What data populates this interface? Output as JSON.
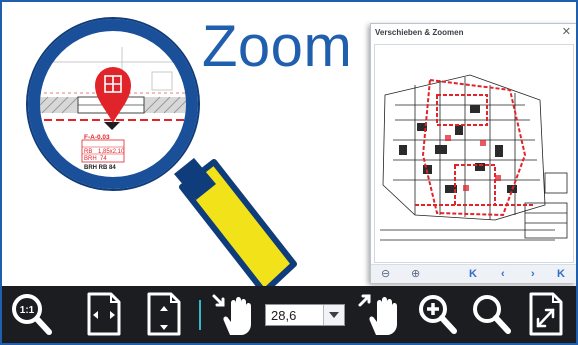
{
  "headline": "Zoom",
  "magnifier": {
    "plan_labels": [
      "F-A-0.03",
      "RB",
      "1,85x2,10",
      "BRH",
      "74",
      "BRH RB 84"
    ]
  },
  "nav_panel": {
    "title": "Verschieben & Zoomen",
    "close_glyph": "✕",
    "nav_buttons": [
      "⊖",
      "⊕",
      "K",
      "‹",
      "›",
      "K"
    ]
  },
  "toolbar": {
    "zoom_value": "28,6",
    "buttons": [
      {
        "name": "zoom-actual-size-button",
        "icon": "magnifier-1to1-icon"
      },
      {
        "name": "fit-width-button",
        "icon": "fit-width-icon"
      },
      {
        "name": "fit-height-button",
        "icon": "fit-height-icon"
      },
      {
        "name": "shrink-button",
        "icon": "shrink-arrows-icon"
      },
      {
        "name": "pan-hand-button",
        "icon": "hand-icon"
      },
      {
        "name": "expand-hand-button",
        "icon": "expand-hand-icon"
      },
      {
        "name": "zoom-in-button",
        "icon": "zoom-in-icon"
      },
      {
        "name": "zoom-out-button",
        "icon": "search-icon"
      },
      {
        "name": "fit-page-button",
        "icon": "fit-page-icon"
      }
    ]
  },
  "colors": {
    "brand_blue": "#1f5fae",
    "toolbar_bg": "#1b1d21",
    "accent_cyan": "#35b9c9",
    "pin_red": "#e1232a",
    "handle_yellow": "#f2e21a"
  }
}
